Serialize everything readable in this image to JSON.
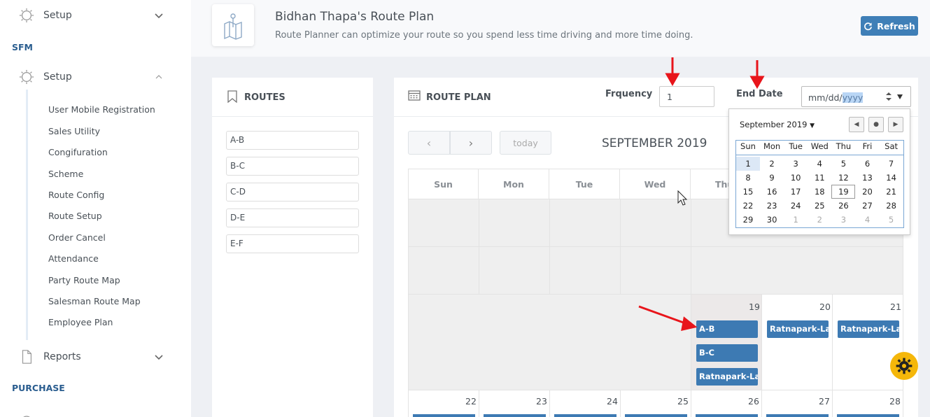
{
  "sidebar": {
    "setup_top": "Setup",
    "section_sfm": "SFM",
    "setup": "Setup",
    "items": [
      {
        "label": "User Mobile Registration"
      },
      {
        "label": "Sales Utility"
      },
      {
        "label": "Congifuration"
      },
      {
        "label": "Scheme"
      },
      {
        "label": "Route Config"
      },
      {
        "label": "Route Setup"
      },
      {
        "label": "Order Cancel"
      },
      {
        "label": "Attendance"
      },
      {
        "label": "Party Route Map"
      },
      {
        "label": "Salesman Route Map"
      },
      {
        "label": "Employee Plan"
      }
    ],
    "reports": "Reports",
    "section_purchase": "PURCHASE"
  },
  "header": {
    "title": "Bidhan Thapa's Route Plan",
    "subtitle": "Route Planner can optimize your route so you spend less time driving and more time doing.",
    "refresh_label": "Refresh"
  },
  "routes": {
    "title": "ROUTES",
    "items": [
      "A-B",
      "B-C",
      "C-D",
      "D-E",
      "E-F"
    ]
  },
  "plan": {
    "title": "ROUTE PLAN",
    "frequency_label": "Frquency",
    "frequency_value": "1",
    "end_date_label": "End Date",
    "end_date_placeholder": "mm/dd/",
    "end_date_year": "yyyy",
    "today_label": "today",
    "calendar_title": "SEPTEMBER 2019",
    "weekdays": [
      "Sun",
      "Mon",
      "Tue",
      "Wed",
      "Thu"
    ],
    "week3_days": [
      "19",
      "20",
      "21"
    ],
    "week4_days": [
      "22",
      "23",
      "24",
      "25",
      "26",
      "27",
      "28"
    ],
    "events_19": [
      "A-B",
      "B-C",
      "Ratnapark-Lazi"
    ],
    "event_20": "Ratnapark-Lazi",
    "event_21": "Ratnapark-Lazi"
  },
  "datepicker": {
    "month_label": "September 2019",
    "weekdays": [
      "Sun",
      "Mon",
      "Tue",
      "Wed",
      "Thu",
      "Fri",
      "Sat"
    ],
    "weeks": [
      [
        "1",
        "2",
        "3",
        "4",
        "5",
        "6",
        "7"
      ],
      [
        "8",
        "9",
        "10",
        "11",
        "12",
        "13",
        "14"
      ],
      [
        "15",
        "16",
        "17",
        "18",
        "19",
        "20",
        "21"
      ],
      [
        "22",
        "23",
        "24",
        "25",
        "26",
        "27",
        "28"
      ],
      [
        "29",
        "30",
        "1",
        "2",
        "3",
        "4",
        "5"
      ]
    ],
    "selected": "1",
    "today": "19"
  },
  "colors": {
    "accent": "#3d7ab3",
    "gear": "#f5b70a",
    "annotation": "#e8151b"
  }
}
